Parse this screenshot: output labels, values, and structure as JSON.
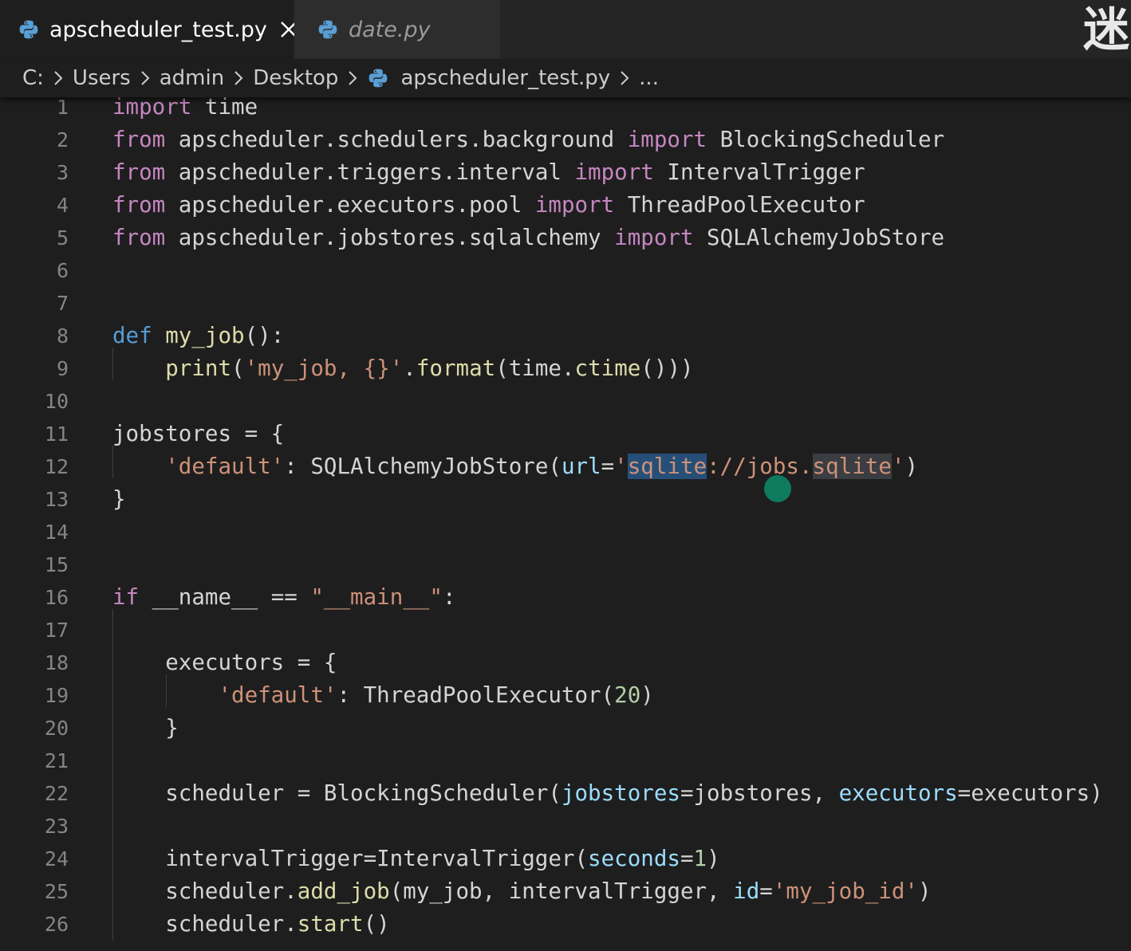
{
  "tabs": [
    {
      "label": "apscheduler_test.py",
      "active": true,
      "icon": "python-icon"
    },
    {
      "label": "date.py",
      "active": false,
      "icon": "python-icon"
    }
  ],
  "corner_glyph": "迷",
  "breadcrumb": {
    "items": [
      "C:",
      "Users",
      "admin",
      "Desktop"
    ],
    "file": "apscheduler_test.py",
    "tail": "..."
  },
  "colors": {
    "editor_bg": "#1e1e1e",
    "tabbar_bg": "#252526",
    "keyword": "#c586c0",
    "def_keyword": "#569cd6",
    "function": "#dcdcaa",
    "string": "#ce9178",
    "number": "#b5cea8",
    "variable": "#9cdcfe",
    "selection": "#264f78",
    "cursor_dot": "#0e7a5e"
  },
  "editor": {
    "lines": [
      {
        "n": "1",
        "tokens": [
          [
            "kw",
            "import"
          ],
          [
            "plain",
            " time"
          ]
        ]
      },
      {
        "n": "2",
        "tokens": [
          [
            "kw",
            "from"
          ],
          [
            "plain",
            " apscheduler.schedulers.background "
          ],
          [
            "kw",
            "import"
          ],
          [
            "plain",
            " BlockingScheduler"
          ]
        ]
      },
      {
        "n": "3",
        "tokens": [
          [
            "kw",
            "from"
          ],
          [
            "plain",
            " apscheduler.triggers.interval "
          ],
          [
            "kw",
            "import"
          ],
          [
            "plain",
            " IntervalTrigger"
          ]
        ]
      },
      {
        "n": "4",
        "tokens": [
          [
            "kw",
            "from"
          ],
          [
            "plain",
            " apscheduler.executors.pool "
          ],
          [
            "kw",
            "import"
          ],
          [
            "plain",
            " ThreadPoolExecutor"
          ]
        ]
      },
      {
        "n": "5",
        "tokens": [
          [
            "kw",
            "from"
          ],
          [
            "plain",
            " apscheduler.jobstores.sqlalchemy "
          ],
          [
            "kw",
            "import"
          ],
          [
            "plain",
            " SQLAlchemyJobStore"
          ]
        ]
      },
      {
        "n": "6",
        "tokens": []
      },
      {
        "n": "7",
        "tokens": []
      },
      {
        "n": "8",
        "tokens": [
          [
            "def",
            "def"
          ],
          [
            "plain",
            " "
          ],
          [
            "fn",
            "my_job"
          ],
          [
            "plain",
            "():"
          ]
        ]
      },
      {
        "n": "9",
        "tokens": [
          [
            "plain",
            "    "
          ],
          [
            "fn",
            "print"
          ],
          [
            "plain",
            "("
          ],
          [
            "str",
            "'my_job, {}'"
          ],
          [
            "plain",
            "."
          ],
          [
            "fn",
            "format"
          ],
          [
            "plain",
            "(time."
          ],
          [
            "fn",
            "ctime"
          ],
          [
            "plain",
            "()))"
          ]
        ]
      },
      {
        "n": "10",
        "tokens": []
      },
      {
        "n": "11",
        "tokens": [
          [
            "plain",
            "jobstores = {"
          ]
        ]
      },
      {
        "n": "12",
        "tokens": [
          [
            "plain",
            "    "
          ],
          [
            "str",
            "'default'"
          ],
          [
            "plain",
            ": SQLAlchemyJobStore("
          ],
          [
            "var",
            "url"
          ],
          [
            "plain",
            "="
          ],
          [
            "str",
            "'"
          ],
          [
            "sel",
            "sqlite"
          ],
          [
            "str",
            "://jobs."
          ],
          [
            "occ",
            "sqlite"
          ],
          [
            "str",
            "'"
          ],
          [
            "plain",
            ")"
          ]
        ]
      },
      {
        "n": "13",
        "tokens": [
          [
            "plain",
            "}"
          ]
        ]
      },
      {
        "n": "14",
        "tokens": []
      },
      {
        "n": "15",
        "tokens": []
      },
      {
        "n": "16",
        "tokens": [
          [
            "kw",
            "if"
          ],
          [
            "plain",
            " __name__ == "
          ],
          [
            "str",
            "\"__main__\""
          ],
          [
            "plain",
            ":"
          ]
        ]
      },
      {
        "n": "17",
        "tokens": []
      },
      {
        "n": "18",
        "tokens": [
          [
            "plain",
            "    executors = {"
          ]
        ]
      },
      {
        "n": "19",
        "tokens": [
          [
            "plain",
            "        "
          ],
          [
            "str",
            "'default'"
          ],
          [
            "plain",
            ": ThreadPoolExecutor("
          ],
          [
            "num",
            "20"
          ],
          [
            "plain",
            ")"
          ]
        ]
      },
      {
        "n": "20",
        "tokens": [
          [
            "plain",
            "    }"
          ]
        ]
      },
      {
        "n": "21",
        "tokens": []
      },
      {
        "n": "22",
        "tokens": [
          [
            "plain",
            "    scheduler = BlockingScheduler("
          ],
          [
            "var",
            "jobstores"
          ],
          [
            "plain",
            "=jobstores, "
          ],
          [
            "var",
            "executors"
          ],
          [
            "plain",
            "=executors)"
          ]
        ]
      },
      {
        "n": "23",
        "tokens": []
      },
      {
        "n": "24",
        "tokens": [
          [
            "plain",
            "    intervalTrigger=IntervalTrigger("
          ],
          [
            "var",
            "seconds"
          ],
          [
            "plain",
            "="
          ],
          [
            "num",
            "1"
          ],
          [
            "plain",
            ")"
          ]
        ]
      },
      {
        "n": "25",
        "tokens": [
          [
            "plain",
            "    scheduler."
          ],
          [
            "fn",
            "add_job"
          ],
          [
            "plain",
            "(my_job, intervalTrigger, "
          ],
          [
            "var",
            "id"
          ],
          [
            "plain",
            "="
          ],
          [
            "str",
            "'my_job_id'"
          ],
          [
            "plain",
            ")"
          ]
        ]
      },
      {
        "n": "26",
        "tokens": [
          [
            "plain",
            "    scheduler."
          ],
          [
            "fn",
            "start"
          ],
          [
            "plain",
            "()"
          ]
        ]
      }
    ]
  }
}
